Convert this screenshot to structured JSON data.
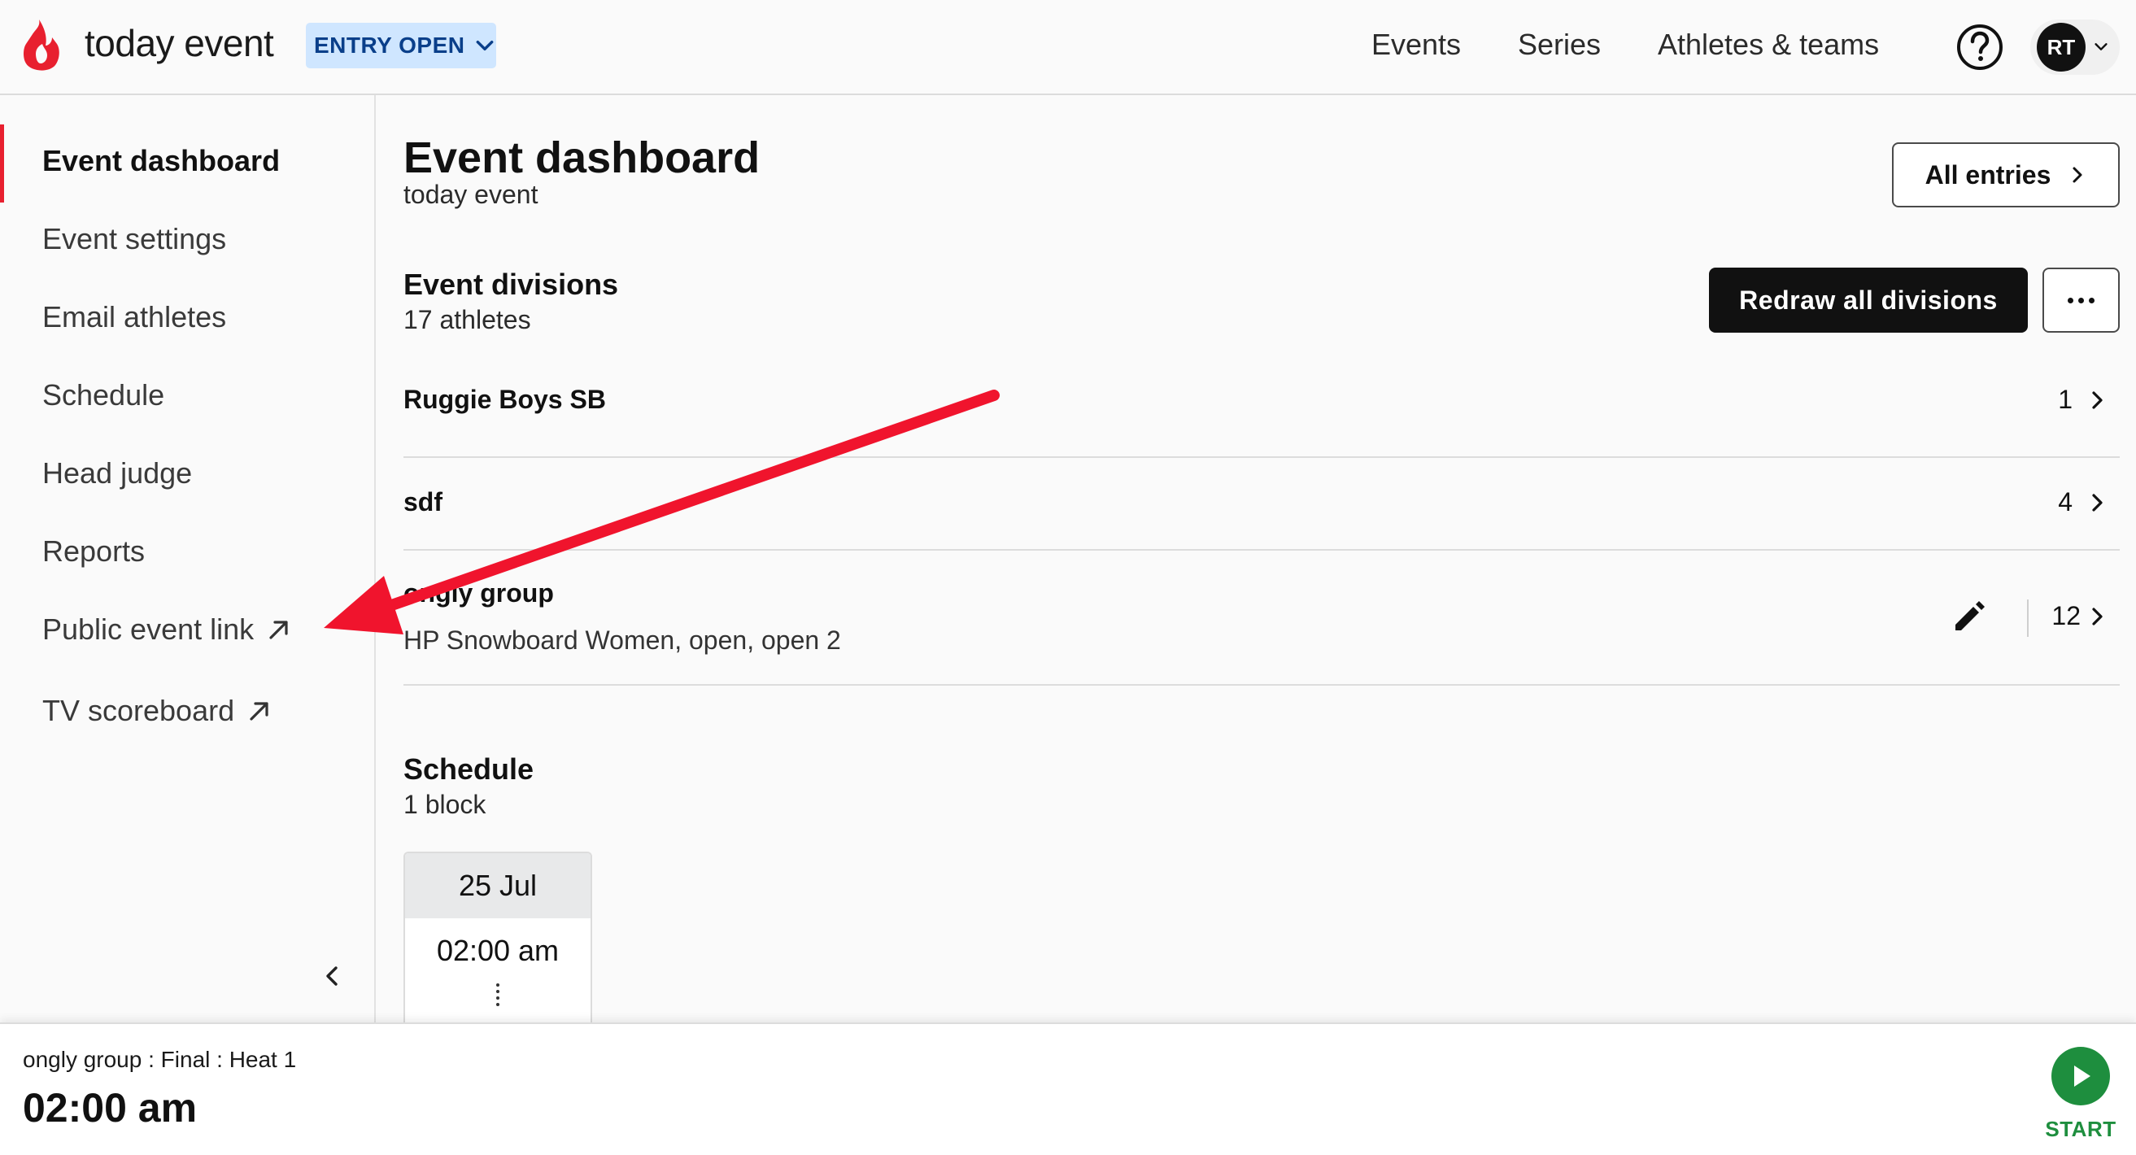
{
  "header": {
    "brand": "today event",
    "status_badge": "ENTRY OPEN",
    "nav": [
      {
        "label": "Events"
      },
      {
        "label": "Series"
      },
      {
        "label": "Athletes & teams"
      }
    ],
    "avatar_initials": "RT"
  },
  "sidebar": {
    "items": [
      {
        "label": "Event dashboard",
        "active": true
      },
      {
        "label": "Event settings"
      },
      {
        "label": "Email athletes"
      },
      {
        "label": "Schedule"
      },
      {
        "label": "Head judge"
      },
      {
        "label": "Reports"
      },
      {
        "label": "Public event link",
        "external": true
      },
      {
        "label": "TV scoreboard",
        "external": true
      }
    ]
  },
  "main": {
    "title": "Event dashboard",
    "subtitle": "today event",
    "all_entries_label": "All entries",
    "divisions": {
      "title": "Event divisions",
      "subtitle": "17 athletes",
      "redraw_label": "Redraw all divisions",
      "rows": [
        {
          "name": "Ruggie Boys SB",
          "description": "",
          "count": "1"
        },
        {
          "name": "sdf",
          "description": "",
          "count": "4"
        },
        {
          "name": "ongly group",
          "description": "HP Snowboard Women, open, open 2",
          "count": "12"
        }
      ]
    },
    "schedule": {
      "title": "Schedule",
      "subtitle": "1 block",
      "blocks": [
        {
          "date": "25 Jul",
          "time": "02:00 am"
        }
      ]
    }
  },
  "bottom_bar": {
    "heat_label": "ongly group : Final : Heat 1",
    "heat_time": "02:00 am",
    "start_label": "START"
  },
  "colors": {
    "brand_red": "#e8202f",
    "badge_bg": "#cfe6ff",
    "badge_text": "#0a3f8a",
    "start_green": "#1e8e3e",
    "annotation_red": "#f0142d"
  }
}
